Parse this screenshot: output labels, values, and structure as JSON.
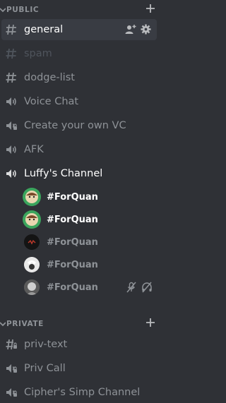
{
  "categories": {
    "public": {
      "label": "PUBLIC"
    },
    "private": {
      "label": "PRIVATE"
    }
  },
  "channels": [
    {
      "label": "general",
      "type": "text",
      "state": "selected"
    },
    {
      "label": "spam",
      "type": "text",
      "state": "muted-dim"
    },
    {
      "label": "dodge-list",
      "type": "text",
      "state": "normal"
    },
    {
      "label": "Voice Chat",
      "type": "voice",
      "state": "normal"
    },
    {
      "label": "Create your own VC",
      "type": "voice-locked",
      "state": "normal"
    },
    {
      "label": "AFK",
      "type": "voice",
      "state": "normal"
    },
    {
      "label": "Luffy's Channel",
      "type": "voice",
      "state": "active"
    }
  ],
  "voice_users": [
    {
      "name": "#ForQuan",
      "state": "speaking-bright",
      "avatar": "green-cartoon"
    },
    {
      "name": "#ForQuan",
      "state": "speaking-bright",
      "avatar": "green-cartoon"
    },
    {
      "name": "#ForQuan",
      "state": "idle",
      "avatar": "dark-red"
    },
    {
      "name": "#ForQuan",
      "state": "idle",
      "avatar": "white-hair"
    },
    {
      "name": "#ForQuan",
      "state": "idle",
      "avatar": "grey-portrait",
      "muted": true,
      "deafened": true
    }
  ],
  "private_channels": [
    {
      "label": "priv-text",
      "type": "text-locked"
    },
    {
      "label": "Priv Call",
      "type": "voice-locked"
    },
    {
      "label": "Cipher's Simp Channel",
      "type": "voice-locked"
    }
  ],
  "colors": {
    "background": "#2f3136",
    "selected": "#393c43",
    "text_white": "#ffffff",
    "text_muted": "#8e9297",
    "text_dim": "#4f545c"
  }
}
